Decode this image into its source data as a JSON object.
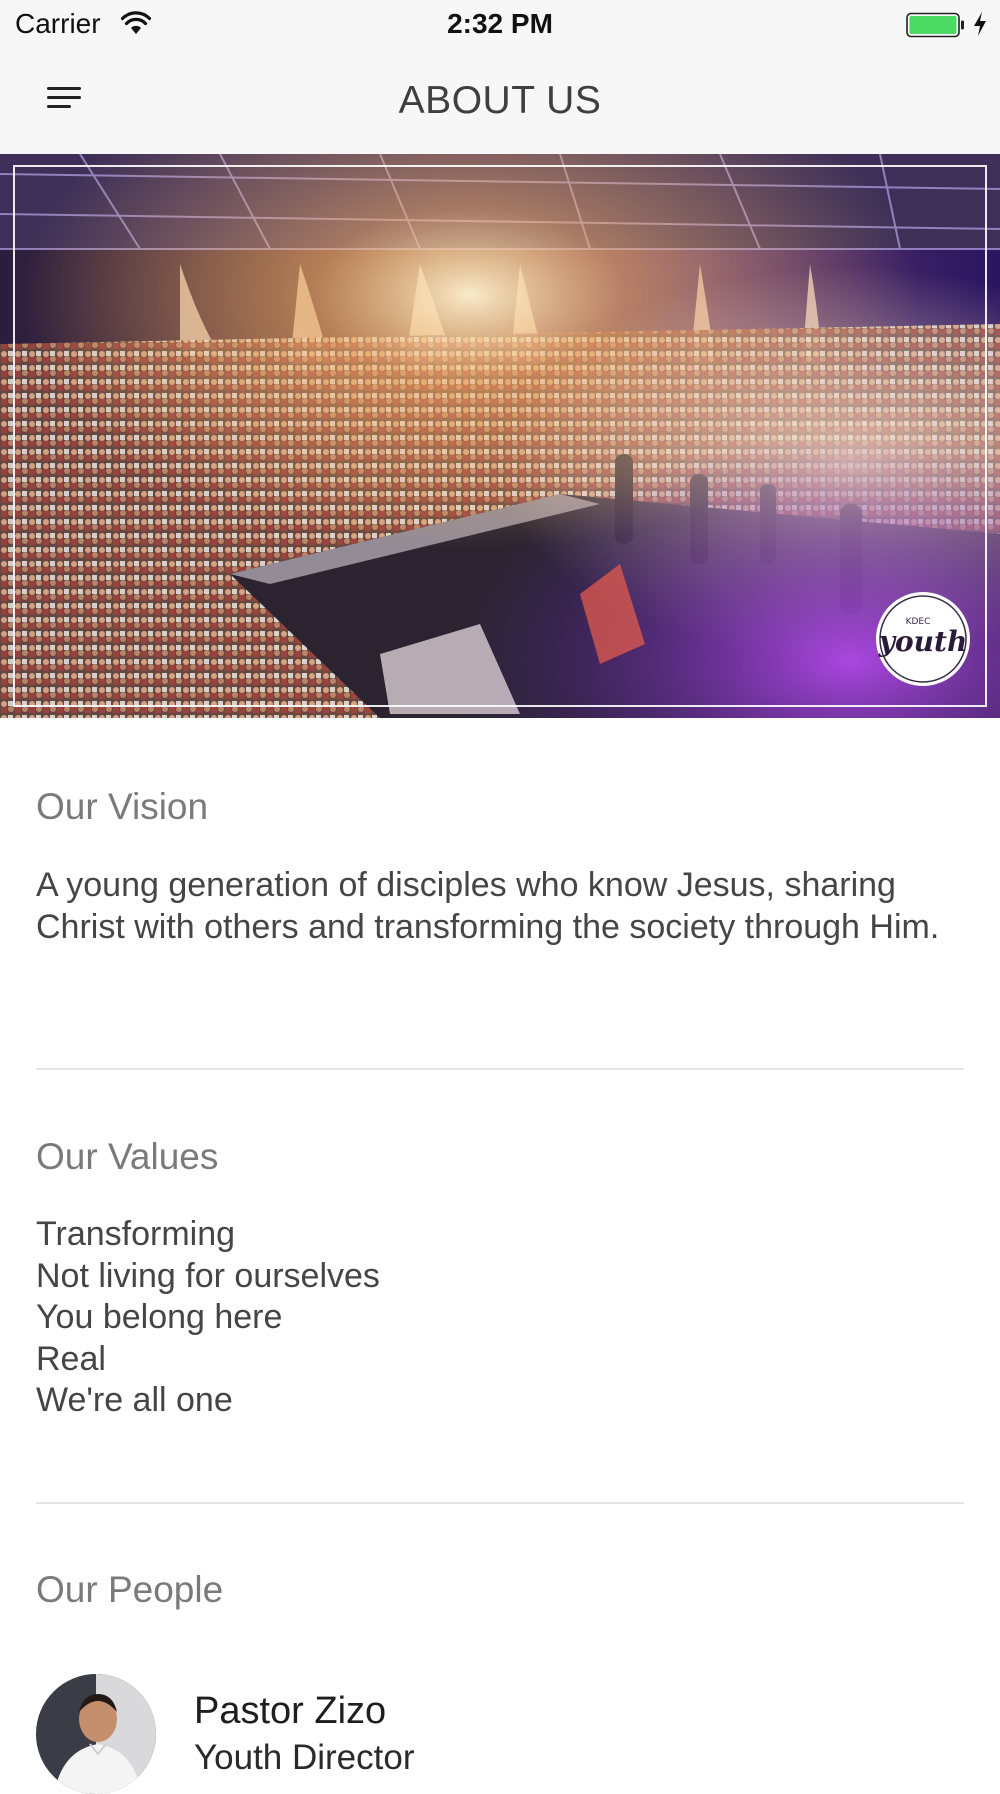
{
  "status_bar": {
    "carrier": "Carrier",
    "time": "2:32 PM",
    "icons": [
      "wifi-icon",
      "battery-icon",
      "charging-icon"
    ],
    "battery_color": "#4cd964"
  },
  "nav": {
    "title": "ABOUT US",
    "menu_icon": "hamburger-menu-icon"
  },
  "hero": {
    "logo_small_text": "KDEC",
    "logo_text": "youth"
  },
  "sections": {
    "vision": {
      "title": "Our Vision",
      "body": "A young generation of disciples who know Jesus, sharing Christ with others and transforming the society through Him."
    },
    "values": {
      "title": "Our Values",
      "items": [
        "Transforming",
        "Not living for ourselves",
        "You belong here",
        "Real",
        "We're all one"
      ]
    },
    "people": {
      "title": "Our People",
      "members": [
        {
          "name": "Pastor Zizo",
          "role": "Youth Director"
        }
      ]
    }
  }
}
